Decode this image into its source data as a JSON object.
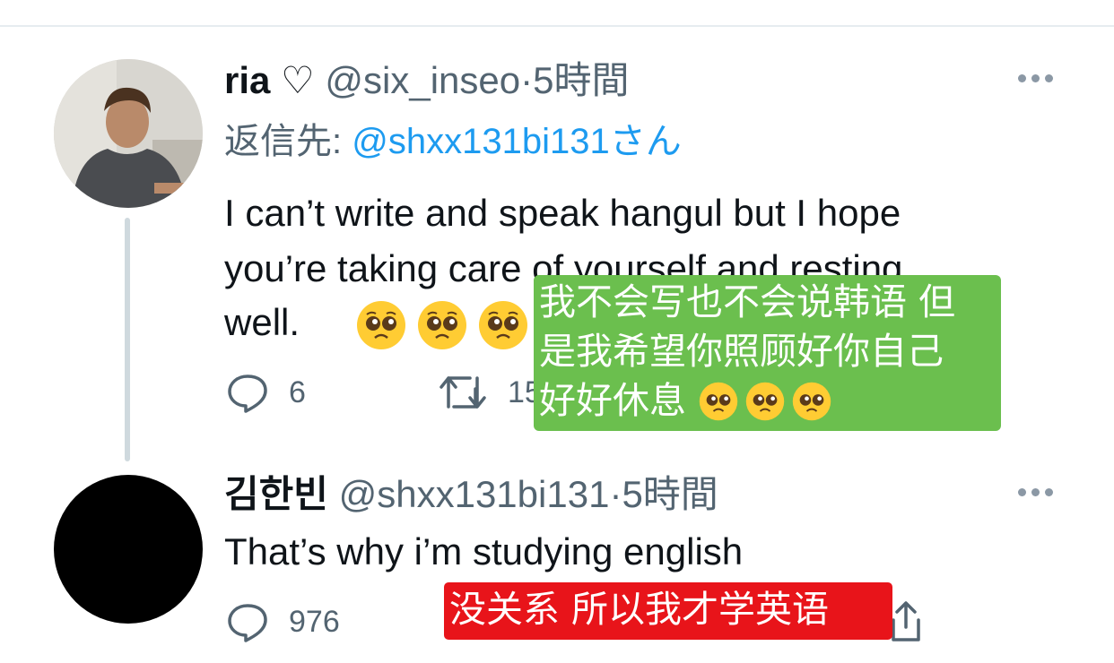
{
  "tweet1": {
    "display_name": "ria",
    "name_badge": "♡",
    "handle": "@six_inseo",
    "separator": "·",
    "time": "5時間",
    "reply_prefix": "返信先: ",
    "reply_to": "@shxx131bi131さん",
    "text_line1": "I can’t write and speak hangul but I hope",
    "text_line2": "you’re taking care of yourself and resting",
    "text_line3": "well.",
    "emojis": [
      "pleading-face",
      "pleading-face",
      "pleading-face"
    ],
    "reply_count": "6",
    "retweet_count_partial": "15"
  },
  "tweet2": {
    "display_name": "김한빈",
    "handle": "@shxx131bi131",
    "separator": "·",
    "time": "5時間",
    "text": "That’s why i’m studying english",
    "reply_count": "976"
  },
  "overlays": {
    "green": {
      "line1": "我不会写也不会说韩语 但",
      "line2": "是我希望你照顾好你自己",
      "line3": "好好休息",
      "color": "#6bbf4e"
    },
    "red": {
      "text": "没关系 所以我才学英语",
      "color": "#e8141a"
    }
  },
  "icons": {
    "more": "more-horizontal-icon",
    "reply": "reply-bubble-icon",
    "retweet": "retweet-icon",
    "share": "share-icon"
  },
  "colors": {
    "link": "#1d9bf0",
    "meta": "#536471",
    "text": "#0f1419"
  }
}
